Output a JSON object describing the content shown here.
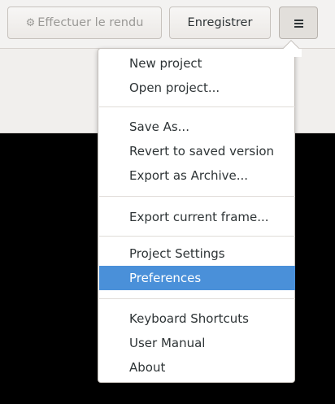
{
  "header": {
    "render_label": "Effectuer le rendu",
    "save_label": "Enregistrer"
  },
  "menu": {
    "items": [
      {
        "label": "New project"
      },
      {
        "label": "Open project..."
      },
      {
        "label": "Save As..."
      },
      {
        "label": "Revert to saved version"
      },
      {
        "label": "Export as Archive..."
      },
      {
        "label": "Export current frame..."
      },
      {
        "label": "Project Settings"
      },
      {
        "label": "Preferences",
        "selected": true
      },
      {
        "label": "Keyboard Shortcuts"
      },
      {
        "label": "User Manual"
      },
      {
        "label": "About"
      }
    ]
  },
  "colors": {
    "selection": "#4a90d9",
    "background_dark": "#000000",
    "header_bg": "#f3f2f1"
  }
}
